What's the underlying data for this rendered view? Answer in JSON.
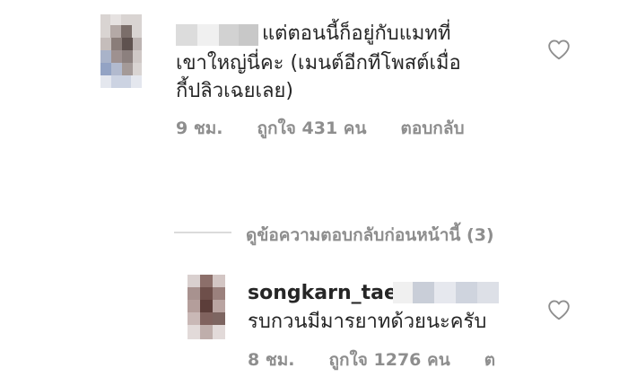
{
  "comment": {
    "text_line1": "แต่ตอนนี้ก็อยู่กับแมทที่",
    "text_line2": "เขาใหญ่นี่คะ (เมนต์อีกทีโพสต์เมื่อ",
    "text_line3": "กี้ปลิวเฉยเลย)",
    "time": "9 ชม.",
    "likes": "ถูกใจ 431 คน",
    "reply": "ตอบกลับ"
  },
  "view_previous_replies": "ดูข้อความตอบกลับก่อนหน้านี้ (3)",
  "reply": {
    "username": "songkarn_tae",
    "text": "รบกวนมีมารยาทด้วยนะครับ",
    "time": "8 ชม.",
    "likes": "ถูกใจ 1276 คน",
    "reply_partial": "ต"
  },
  "icons": {
    "like": "heart-outline-icon"
  },
  "colors": {
    "text": "#262626",
    "meta": "#8e8e8e",
    "divider": "#dbdbdb"
  }
}
